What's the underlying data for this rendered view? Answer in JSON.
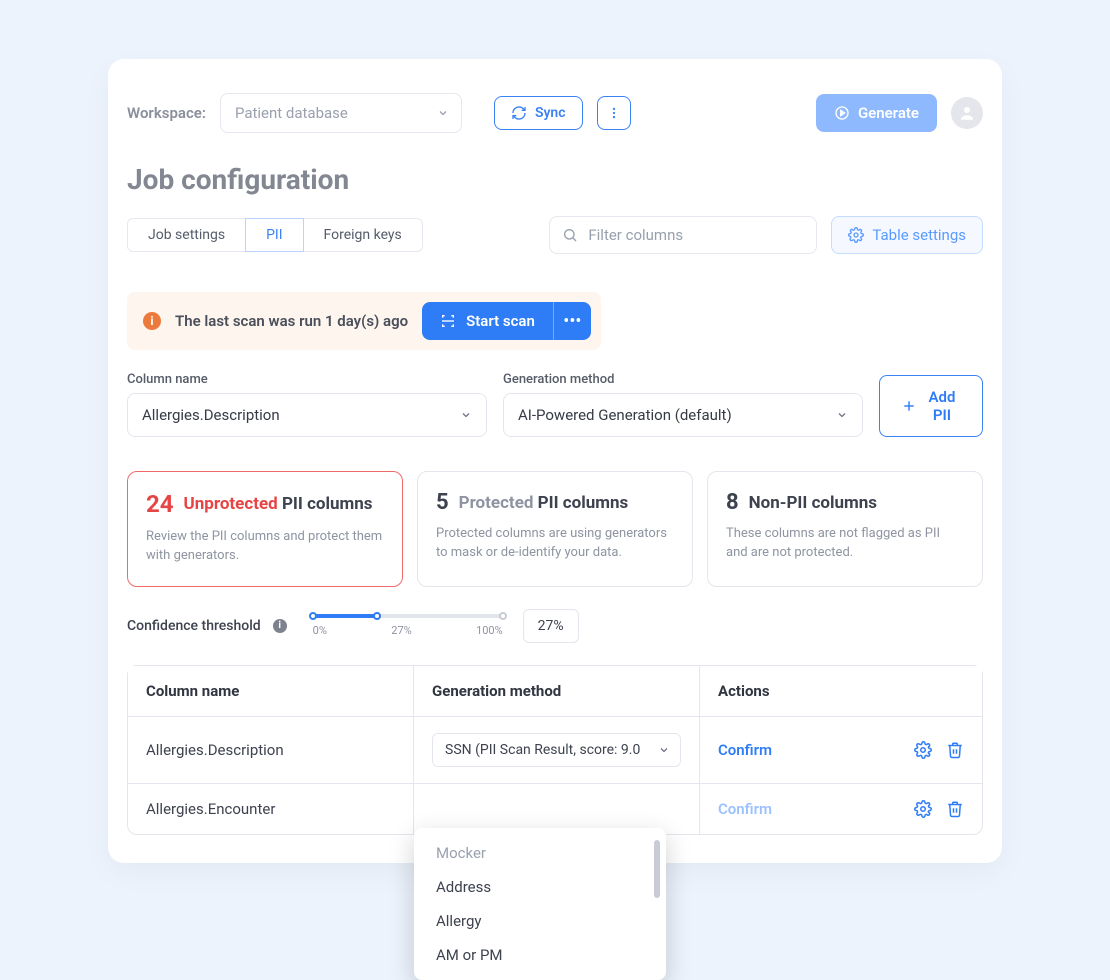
{
  "topbar": {
    "workspace_label": "Workspace:",
    "workspace_value": "Patient database",
    "sync_label": "Sync",
    "generate_label": "Generate"
  },
  "page_title": "Job configuration",
  "tabs": {
    "job_settings": "Job settings",
    "pii": "PII",
    "foreign_keys": "Foreign keys"
  },
  "filter_placeholder": "Filter columns",
  "table_settings_label": "Table settings",
  "banner": {
    "text": "The last scan was run 1 day(s) ago",
    "start_scan": "Start scan"
  },
  "controls": {
    "column_name_label": "Column name",
    "column_name_value": "Allergies.Description",
    "method_label": "Generation method",
    "method_value": "AI-Powered Generation (default)",
    "add_pii_label": "Add PII"
  },
  "cards": {
    "unprotected": {
      "count": "24",
      "label_pre": "Unprotected",
      "label_post": " PII columns",
      "desc": "Review the PII columns and protect them with generators."
    },
    "protected": {
      "count": "5",
      "label_pre": "Protected",
      "label_post": " PII columns",
      "desc": "Protected columns are using generators to mask or de-identify your data."
    },
    "nonpii": {
      "count": "8",
      "label": "Non-PII columns",
      "desc": "These columns are not flagged as PII and are not protected."
    }
  },
  "threshold": {
    "label": "Confidence threshold",
    "tick_min": "0%",
    "tick_mid": "27%",
    "tick_max": "100%",
    "value": "27%"
  },
  "table": {
    "headers": {
      "name": "Column name",
      "method": "Generation method",
      "actions": "Actions"
    },
    "row1": {
      "name": "Allergies.Description",
      "method": "SSN (PII Scan Result, score: 9.0",
      "confirm": "Confirm"
    },
    "row2": {
      "name": "Allergies.Encounter",
      "confirm": "Confirm"
    }
  },
  "dropdown": {
    "header": "Mocker",
    "opt1": "Address",
    "opt2": "Allergy",
    "opt3": "AM or PM"
  }
}
